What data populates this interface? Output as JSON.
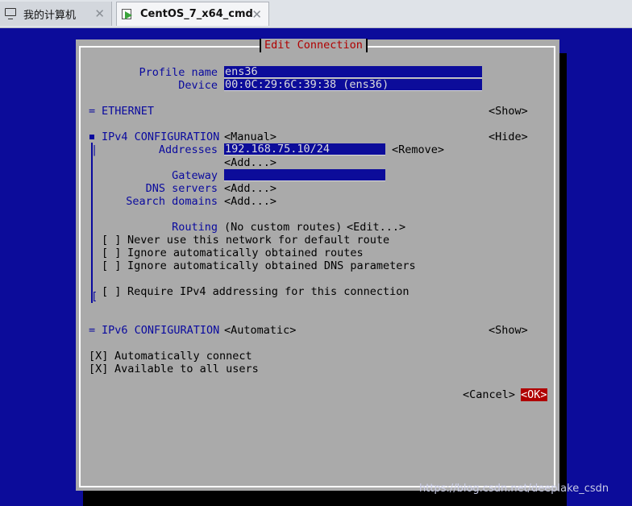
{
  "tabs": [
    {
      "label": "我的计算机",
      "icon": "monitor-icon",
      "close": "✕"
    },
    {
      "label": "CentOS_7_x64_cmd",
      "icon": "vm-icon",
      "close": "✕"
    }
  ],
  "dialog": {
    "title": "Edit Connection",
    "profile_name_label": "Profile name",
    "profile_name_value": "ens36",
    "device_label": "Device",
    "device_value": "00:0C:29:6C:39:38 (ens36)",
    "ethernet": {
      "marker": "=",
      "label": "ETHERNET",
      "toggle": "<Show>"
    },
    "ipv4": {
      "label": "IPv4 CONFIGURATION",
      "method": "<Manual>",
      "toggle": "<Hide>",
      "addresses_label": "Addresses",
      "address_value": "192.168.75.10/24",
      "remove_button": "<Remove>",
      "add_address_button": "<Add...>",
      "gateway_label": "Gateway",
      "gateway_value": "",
      "dns_label": "DNS servers",
      "dns_add_button": "<Add...>",
      "search_label": "Search domains",
      "search_add_button": "<Add...>",
      "routing_label": "Routing",
      "routing_value": "(No custom routes)",
      "routing_edit_button": "<Edit...>",
      "checkboxes": [
        {
          "mark": "[ ]",
          "label": "Never use this network for default route"
        },
        {
          "mark": "[ ]",
          "label": "Ignore automatically obtained routes"
        },
        {
          "mark": "[ ]",
          "label": "Ignore automatically obtained DNS parameters"
        },
        {
          "mark": "[ ]",
          "label": "Require IPv4 addressing for this connection"
        }
      ]
    },
    "ipv6": {
      "marker": "=",
      "label": "IPv6 CONFIGURATION",
      "method": "<Automatic>",
      "toggle": "<Show>"
    },
    "auto_connect": {
      "mark": "[X]",
      "label": "Automatically connect"
    },
    "all_users": {
      "mark": "[X]",
      "label": "Available to all users"
    },
    "cancel_button": "<Cancel>",
    "ok_button": "<OK>"
  },
  "watermark": "https://blog.csdn.net/deeplake_csdn",
  "colors": {
    "console_bg": "#0c0c9a",
    "dialog_bg": "#aaaaaa",
    "title": "#b00000",
    "label_blue": "#0a0a9e",
    "ok_bg": "#b00000"
  }
}
